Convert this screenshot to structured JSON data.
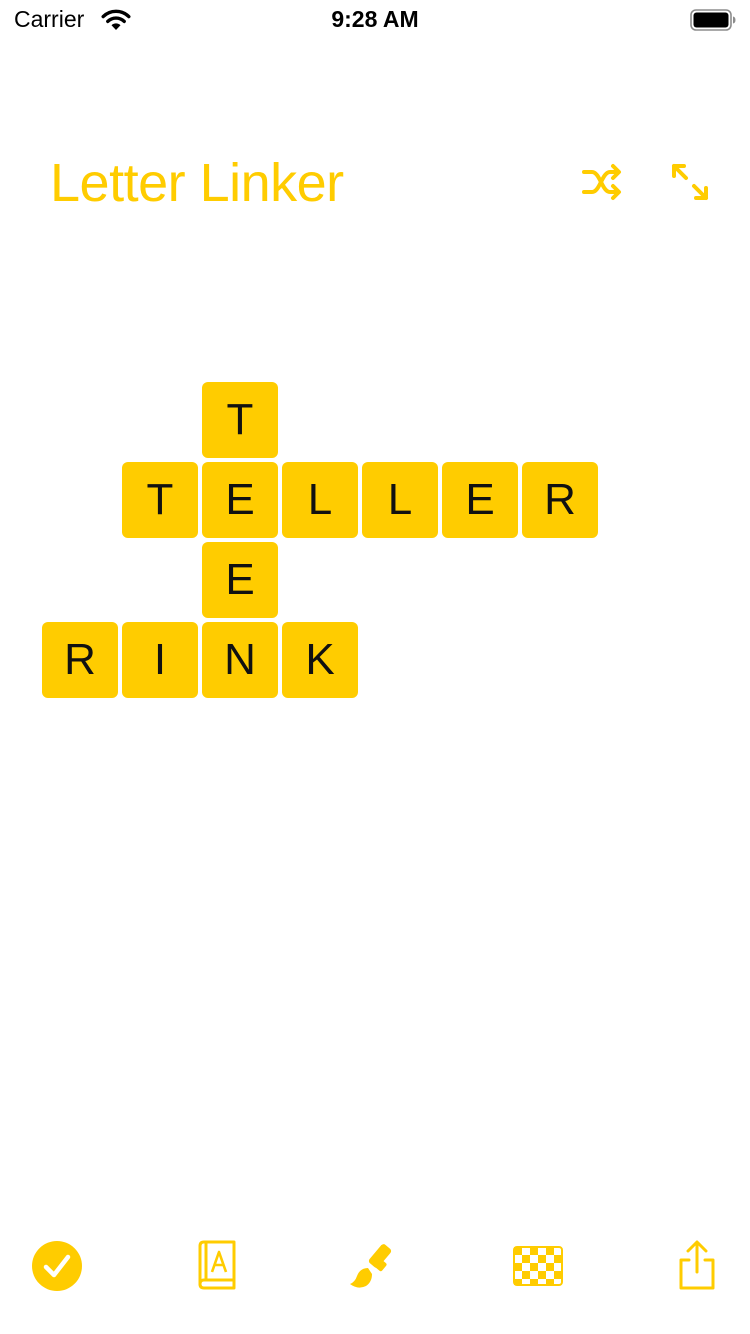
{
  "status_bar": {
    "carrier": "Carrier",
    "time": "9:28 AM",
    "icons": [
      "wifi-icon",
      "battery-icon"
    ]
  },
  "header": {
    "title": "Letter Linker",
    "buttons": [
      {
        "name": "shuffle-button",
        "icon": "shuffle-icon"
      },
      {
        "name": "expand-button",
        "icon": "expand-icon"
      }
    ]
  },
  "board": {
    "tiles": [
      {
        "letter": "T"
      },
      {
        "letter": "T"
      },
      {
        "letter": "E"
      },
      {
        "letter": "L"
      },
      {
        "letter": "L"
      },
      {
        "letter": "E"
      },
      {
        "letter": "R"
      },
      {
        "letter": "E"
      },
      {
        "letter": "R"
      },
      {
        "letter": "I"
      },
      {
        "letter": "N"
      },
      {
        "letter": "K"
      }
    ]
  },
  "toolbar": {
    "items": [
      {
        "name": "check-button",
        "icon": "checkmark-circle-icon"
      },
      {
        "name": "dictionary-button",
        "icon": "book-icon"
      },
      {
        "name": "theme-button",
        "icon": "paintbrush-icon"
      },
      {
        "name": "pattern-button",
        "icon": "checkerboard-icon"
      },
      {
        "name": "share-button",
        "icon": "share-icon"
      }
    ]
  },
  "colors": {
    "accent": "#ffcc00",
    "tile": "#ffcc00",
    "tile_text": "#111111",
    "background": "#ffffff"
  }
}
